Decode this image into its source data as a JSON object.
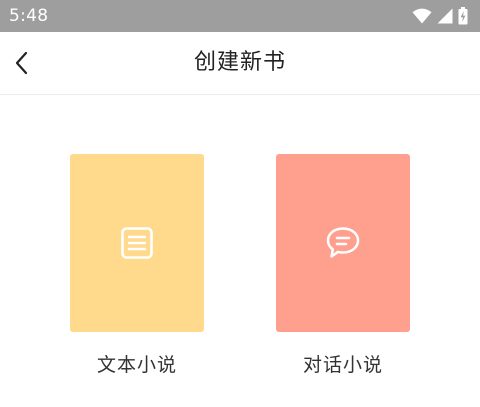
{
  "status_bar": {
    "time": "5:48",
    "icons": [
      "wifi-icon",
      "signal-icon",
      "battery-icon"
    ]
  },
  "header": {
    "back_icon": "chevron-left-icon",
    "title": "创建新书"
  },
  "options": [
    {
      "label": "文本小说",
      "icon": "document-icon",
      "card_color": "#ffd98c"
    },
    {
      "label": "对话小说",
      "icon": "chat-bubble-icon",
      "card_color": "#ffa08f"
    }
  ]
}
